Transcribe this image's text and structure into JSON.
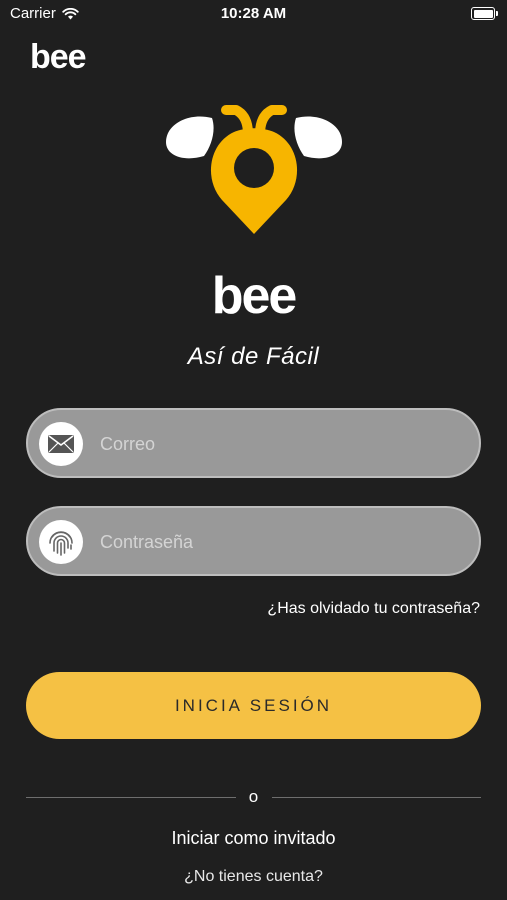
{
  "status_bar": {
    "carrier": "Carrier",
    "time": "10:28 AM"
  },
  "brand": {
    "top_name": "bee",
    "logo_name": "bee",
    "tagline": "Así de Fácil",
    "accent_color": "#f5c144"
  },
  "form": {
    "email_placeholder": "Correo",
    "email_value": "",
    "password_placeholder": "Contraseña",
    "password_value": "",
    "forgot_link": "¿Has olvidado tu contraseña?",
    "login_button": "INICIA SESIÓN"
  },
  "divider": {
    "text": "o"
  },
  "guest_link": "Iniciar como invitado",
  "signup_link": "¿No tienes cuenta?",
  "icons": [
    "wifi-icon",
    "battery-icon",
    "bee-logo-icon",
    "mail-icon",
    "fingerprint-icon"
  ]
}
